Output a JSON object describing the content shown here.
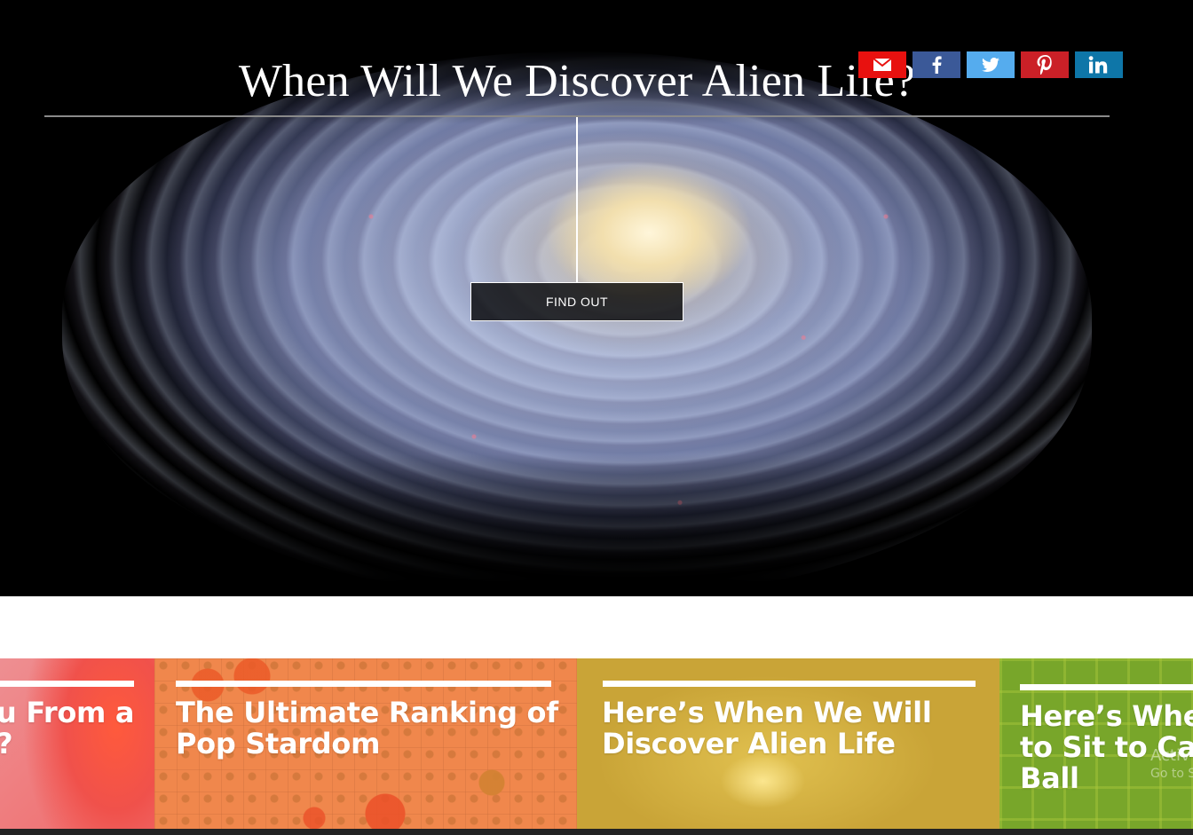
{
  "hero": {
    "title": "When Will We Discover Alien Life?",
    "button_label": "FIND OUT"
  },
  "share": {
    "buttons": [
      {
        "icon": "email-icon",
        "color": "#e8110f"
      },
      {
        "icon": "facebook-icon",
        "color": "#3b5998"
      },
      {
        "icon": "twitter-icon",
        "color": "#55acee"
      },
      {
        "icon": "pinterest-icon",
        "color": "#cb2027"
      },
      {
        "icon": "linkedin-icon",
        "color": "#0e76a8"
      }
    ]
  },
  "cards": [
    {
      "title_lines": [
        "u From a",
        "?"
      ]
    },
    {
      "title_lines": [
        "The Ultimate Ranking of",
        "Pop Stardom"
      ]
    },
    {
      "title_lines": [
        "Here’s When We Will",
        "Discover Alien Life"
      ]
    },
    {
      "title_lines": [
        "Here’s Whe",
        "to Sit to Ca",
        "Ball"
      ]
    }
  ],
  "watermark": {
    "line1": "Activ",
    "line2": "Go to S"
  }
}
